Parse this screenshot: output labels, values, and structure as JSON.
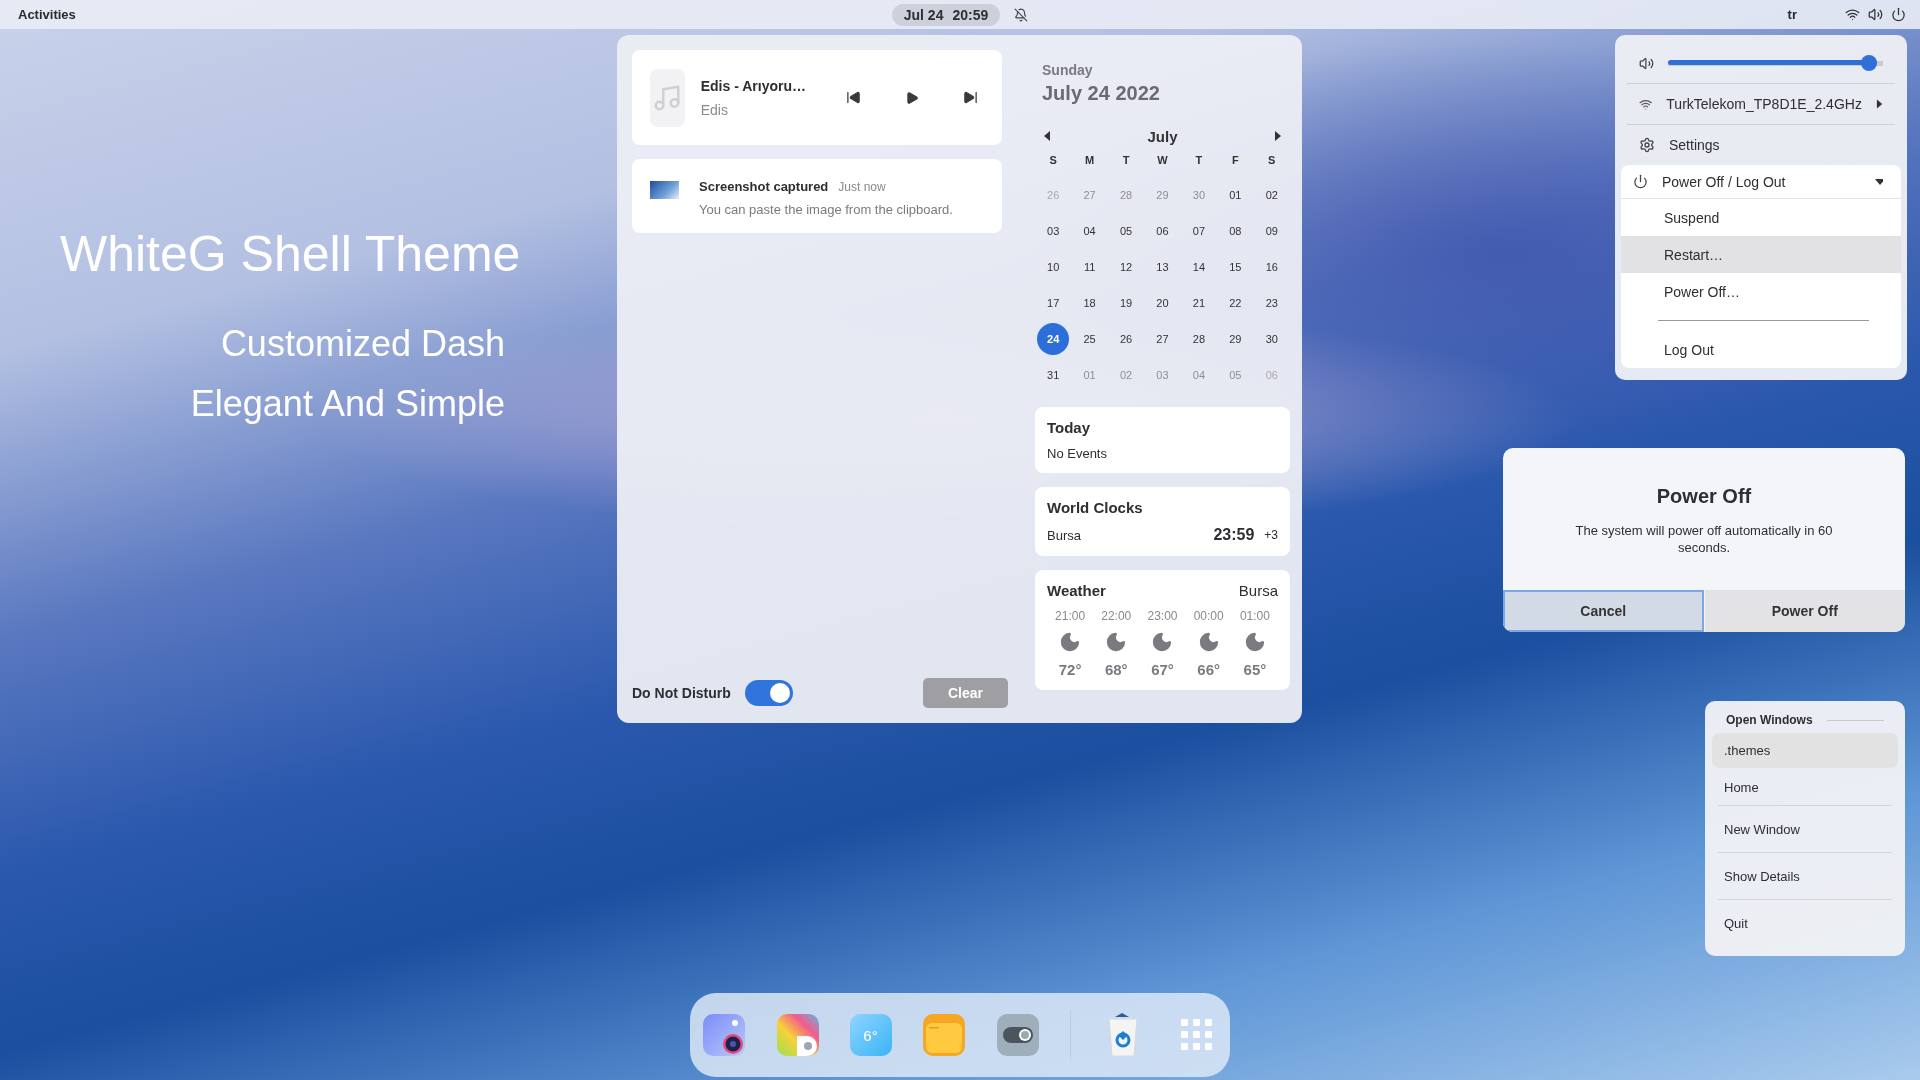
{
  "top_bar": {
    "activities": "Activities",
    "date": "Jul 24",
    "time": "20:59",
    "notifications_muted": true,
    "keyboard": "tr"
  },
  "desktop_text": {
    "title": "WhiteG Shell Theme",
    "lines": [
      "Customized Dash",
      "Elegant And Simple"
    ]
  },
  "media": {
    "title": "Edis - Arıyoru…",
    "artist": "Edis"
  },
  "notification": {
    "title": "Screenshot captured",
    "time": "Just now",
    "body": "You can paste the image from the clipboard."
  },
  "dnd": {
    "label": "Do Not Disturb",
    "on": true
  },
  "clear": "Clear",
  "calendar": {
    "weekday": "Sunday",
    "date": "July 24 2022",
    "month": "July",
    "weekdays": [
      "S",
      "M",
      "T",
      "W",
      "T",
      "F",
      "S"
    ],
    "days": [
      {
        "label": "26",
        "kind": "faint",
        "selected": false
      },
      {
        "label": "27",
        "kind": "other",
        "selected": false
      },
      {
        "label": "28",
        "kind": "other",
        "selected": false
      },
      {
        "label": "29",
        "kind": "other",
        "selected": false
      },
      {
        "label": "30",
        "kind": "other",
        "selected": false
      },
      {
        "label": "01",
        "kind": "day",
        "selected": false
      },
      {
        "label": "02",
        "kind": "day",
        "selected": false
      },
      {
        "label": "03",
        "kind": "day",
        "selected": false
      },
      {
        "label": "04",
        "kind": "day",
        "selected": false
      },
      {
        "label": "05",
        "kind": "day",
        "selected": false
      },
      {
        "label": "06",
        "kind": "day",
        "selected": false
      },
      {
        "label": "07",
        "kind": "day",
        "selected": false
      },
      {
        "label": "08",
        "kind": "day",
        "selected": false
      },
      {
        "label": "09",
        "kind": "day",
        "selected": false
      },
      {
        "label": "10",
        "kind": "day",
        "selected": false
      },
      {
        "label": "11",
        "kind": "day",
        "selected": false
      },
      {
        "label": "12",
        "kind": "day",
        "selected": false
      },
      {
        "label": "13",
        "kind": "day",
        "selected": false
      },
      {
        "label": "14",
        "kind": "day",
        "selected": false
      },
      {
        "label": "15",
        "kind": "day",
        "selected": false
      },
      {
        "label": "16",
        "kind": "day",
        "selected": false
      },
      {
        "label": "17",
        "kind": "day",
        "selected": false
      },
      {
        "label": "18",
        "kind": "day",
        "selected": false
      },
      {
        "label": "19",
        "kind": "day",
        "selected": false
      },
      {
        "label": "20",
        "kind": "day",
        "selected": false
      },
      {
        "label": "21",
        "kind": "day",
        "selected": false
      },
      {
        "label": "22",
        "kind": "day",
        "selected": false
      },
      {
        "label": "23",
        "kind": "day",
        "selected": false
      },
      {
        "label": "24",
        "kind": "day",
        "selected": true
      },
      {
        "label": "25",
        "kind": "day",
        "selected": false
      },
      {
        "label": "26",
        "kind": "day",
        "selected": false
      },
      {
        "label": "27",
        "kind": "day",
        "selected": false
      },
      {
        "label": "28",
        "kind": "day",
        "selected": false
      },
      {
        "label": "29",
        "kind": "day",
        "selected": false
      },
      {
        "label": "30",
        "kind": "day",
        "selected": false
      },
      {
        "label": "31",
        "kind": "day",
        "selected": false
      },
      {
        "label": "01",
        "kind": "other",
        "selected": false
      },
      {
        "label": "02",
        "kind": "other",
        "selected": false
      },
      {
        "label": "03",
        "kind": "other",
        "selected": false
      },
      {
        "label": "04",
        "kind": "other",
        "selected": false
      },
      {
        "label": "05",
        "kind": "other",
        "selected": false
      },
      {
        "label": "06",
        "kind": "faint",
        "selected": false
      }
    ]
  },
  "today": {
    "title": "Today",
    "text": "No Events"
  },
  "world_clocks": {
    "title": "World Clocks",
    "clocks": [
      {
        "city": "Bursa",
        "time": "23:59",
        "offset": "+3"
      }
    ]
  },
  "weather": {
    "title": "Weather",
    "location": "Bursa",
    "hours": [
      {
        "time": "21:00",
        "temp": "72°"
      },
      {
        "time": "22:00",
        "temp": "68°"
      },
      {
        "time": "23:00",
        "temp": "67°"
      },
      {
        "time": "00:00",
        "temp": "66°"
      },
      {
        "time": "01:00",
        "temp": "65°"
      }
    ]
  },
  "quick_settings": {
    "volume": {
      "level": 0.97
    },
    "wifi": {
      "name": "TurkTelekom_TP8D1E_2.4GHz"
    },
    "settings": "Settings",
    "power": {
      "label": "Power Off / Log Out",
      "expanded": true,
      "items": [
        {
          "kind": "item",
          "label": "Suspend",
          "selected": false
        },
        {
          "kind": "item",
          "label": "Restart…",
          "selected": true
        },
        {
          "kind": "item",
          "label": "Power Off…",
          "selected": false
        },
        {
          "kind": "separator"
        },
        {
          "kind": "item",
          "label": "Log Out",
          "selected": false
        }
      ]
    }
  },
  "power_dialog": {
    "title": "Power Off",
    "message": "The system will power off automatically in 60 seconds.",
    "buttons": [
      {
        "label": "Cancel",
        "selected": true
      },
      {
        "label": "Power Off",
        "selected": false
      }
    ]
  },
  "window_menu": {
    "heading": "Open Windows",
    "windows": [
      {
        "label": ".themes",
        "selected": true
      },
      {
        "label": "Home",
        "selected": false
      }
    ],
    "actions": [
      "New Window",
      "Show Details",
      "Quit"
    ]
  },
  "dock": {
    "apps": [
      {
        "kind": "camera"
      },
      {
        "kind": "photos"
      },
      {
        "kind": "weather",
        "label": "6°"
      },
      {
        "kind": "files"
      },
      {
        "kind": "toggle"
      },
      {
        "kind": "separator"
      },
      {
        "kind": "trash"
      },
      {
        "kind": "grid"
      }
    ]
  }
}
